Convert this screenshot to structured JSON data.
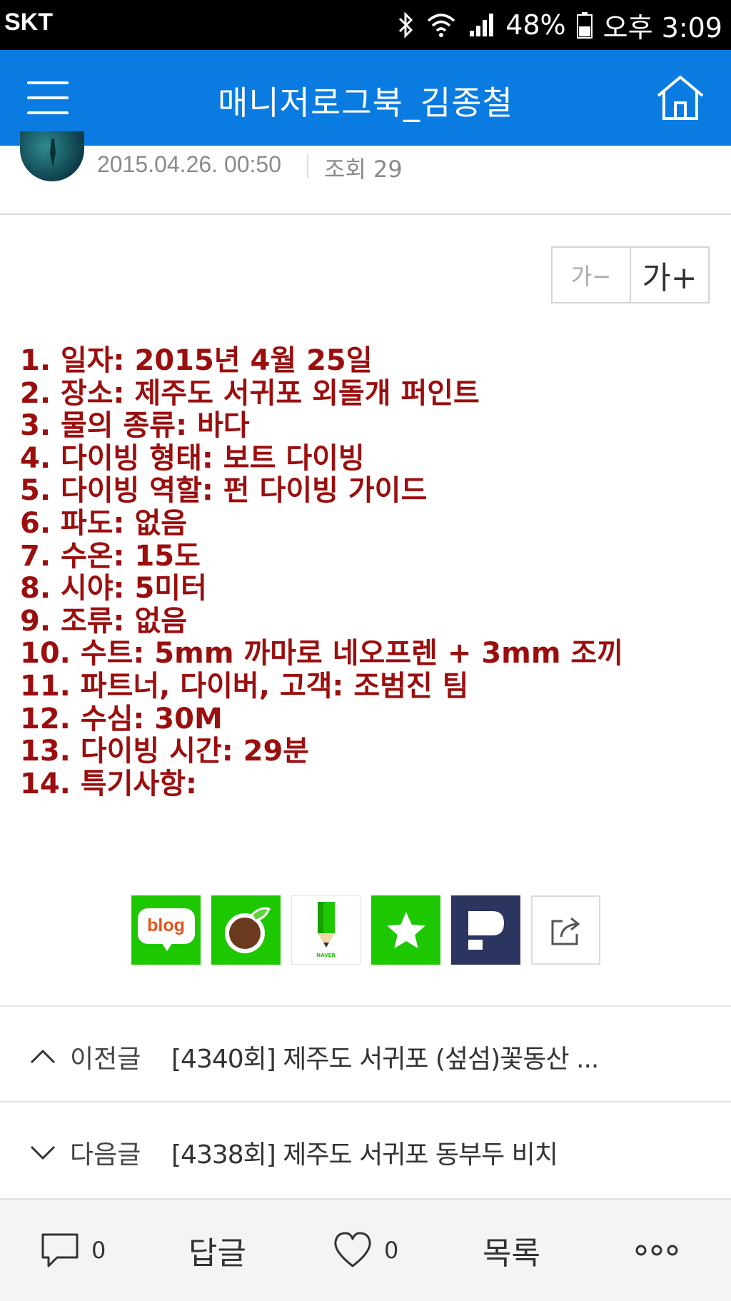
{
  "status_bar": {
    "carrier": "SKT",
    "battery": "48%",
    "time": "오후 3:09"
  },
  "app_bar": {
    "title": "매니저로그북_김종철"
  },
  "post_meta": {
    "date": "2015.04.26. 00:50",
    "views": "조회 29"
  },
  "font_size": {
    "smaller": "가−",
    "larger": "가+"
  },
  "content": {
    "lines": [
      "1. 일자: 2015년 4월 25일",
      "2. 장소: 제주도 서귀포 외돌개 퍼인트",
      "3. 물의 종류: 바다",
      "4. 다이빙 형태: 보트 다이빙",
      "5. 다이빙 역할: 펀 다이빙 가이드",
      "6. 파도: 없음",
      "7. 수온: 15도",
      "8. 시야: 5미터",
      "9. 조류: 없음",
      "10. 수트: 5mm 까마로 네오프렌 + 3mm 조끼",
      "11. 파트너, 다이버, 고객: 조범진 팀",
      "12. 수심: 30M",
      "13. 다이빙 시간: 29분",
      "14. 특기사항:"
    ]
  },
  "share": {
    "blog_label": "blog",
    "memo_label": "NAVER",
    "colors": {
      "green": "#1ec800",
      "dark": "#2b3560"
    }
  },
  "prev_post": {
    "label": "이전글",
    "title": "[4340회] 제주도 서귀포 (섶섬)꽃동산 ..."
  },
  "next_post": {
    "label": "다음글",
    "title": "[4338회] 제주도 서귀포 동부두 비치"
  },
  "bottom_bar": {
    "comment_count": "0",
    "reply": "답글",
    "like_count": "0",
    "list": "목록"
  }
}
